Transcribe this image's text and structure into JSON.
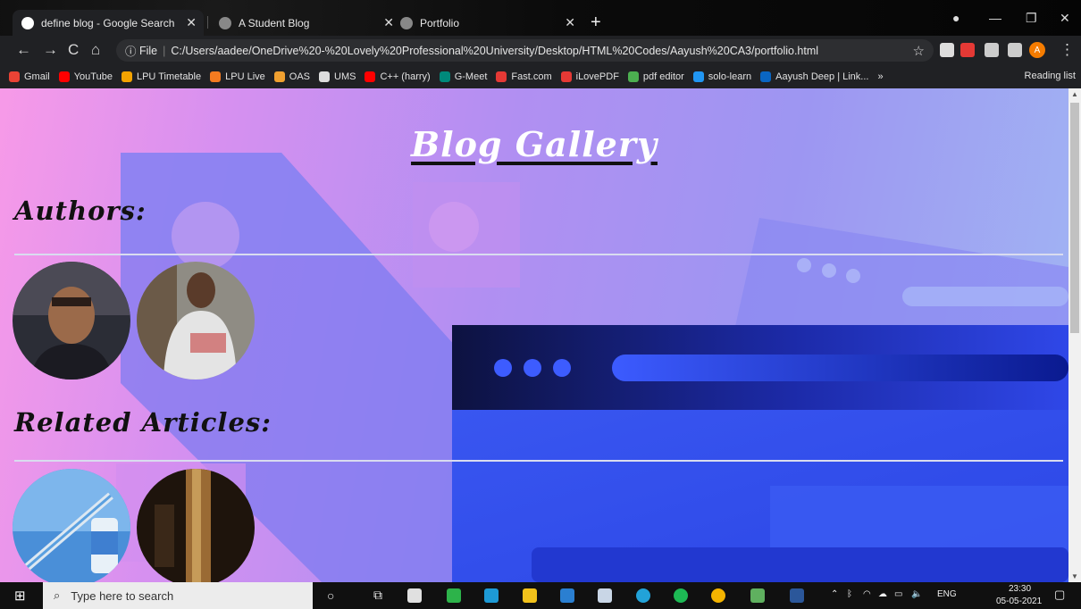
{
  "browser": {
    "tabs": [
      {
        "title": "define blog - Google Search"
      },
      {
        "title": "A Student Blog"
      },
      {
        "title": "Portfolio"
      }
    ],
    "address": {
      "scheme": "File",
      "url": "C:/Users/aadee/OneDrive%20-%20Lovely%20Professional%20University/Desktop/HTML%20Codes/Aayush%20CA3/portfolio.html"
    },
    "profile_initial": "A",
    "bookmarks": [
      {
        "label": "Gmail",
        "color": "#ea4335"
      },
      {
        "label": "YouTube",
        "color": "#ff0000"
      },
      {
        "label": "LPU Timetable",
        "color": "#f4a300"
      },
      {
        "label": "LPU Live",
        "color": "#f47b20"
      },
      {
        "label": "OAS",
        "color": "#f0a030"
      },
      {
        "label": "UMS",
        "color": "#dddddd"
      },
      {
        "label": "C++ (harry)",
        "color": "#ff0000"
      },
      {
        "label": "G-Meet",
        "color": "#00897b"
      },
      {
        "label": "Fast.com",
        "color": "#e53935"
      },
      {
        "label": "iLovePDF",
        "color": "#e53935"
      },
      {
        "label": "pdf editor",
        "color": "#4caf50"
      },
      {
        "label": "solo-learn",
        "color": "#2196f3"
      },
      {
        "label": "Aayush Deep | Link...",
        "color": "#0a66c2"
      }
    ],
    "reading_list": "Reading list"
  },
  "page": {
    "title": "Blog Gallery",
    "authors_heading": "Authors:",
    "related_heading": "Related Articles:"
  },
  "taskbar": {
    "search_placeholder": "Type here to search",
    "language": "ENG",
    "time": "23:30",
    "date": "05-05-2021"
  }
}
